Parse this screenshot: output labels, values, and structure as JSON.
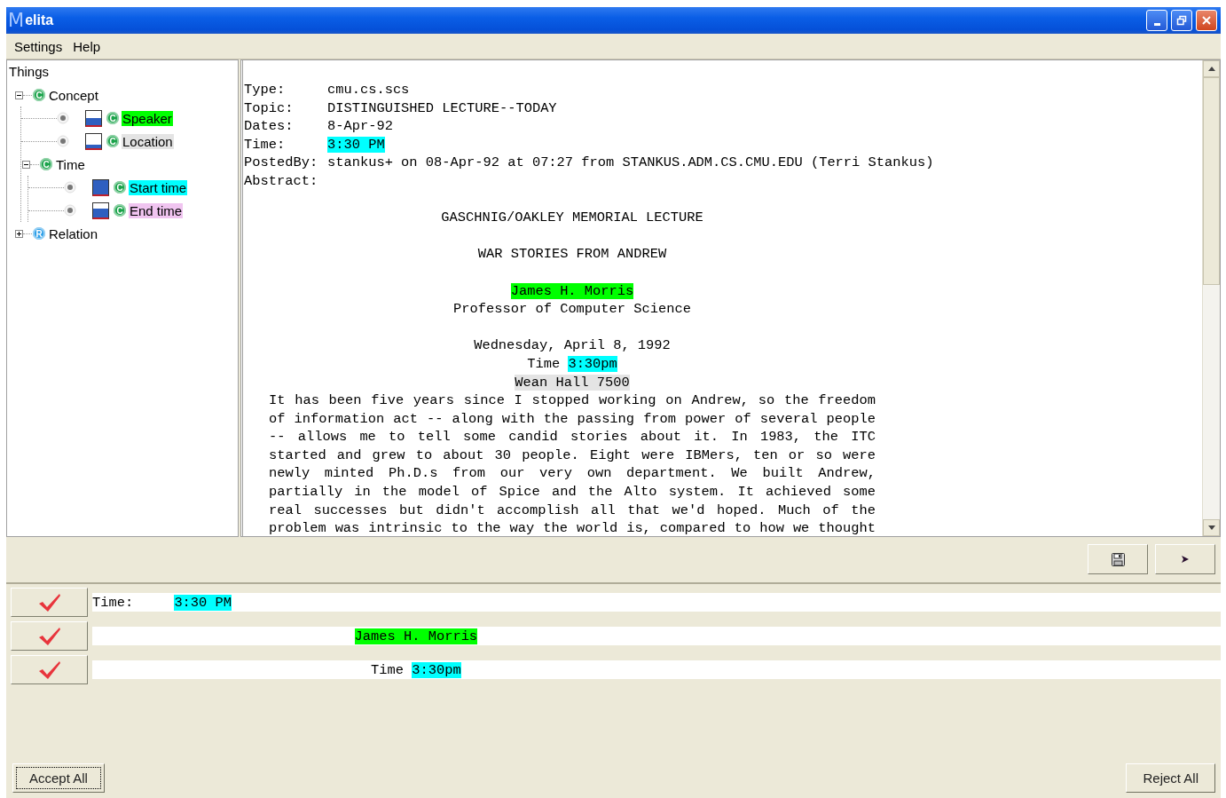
{
  "window": {
    "logo": "M",
    "title": "elita"
  },
  "menu": [
    {
      "label": "Settings"
    },
    {
      "label": "Help"
    }
  ],
  "tree": {
    "title": "Things",
    "items": [
      {
        "kind": "group",
        "badge": {
          "kind": "class",
          "letter": "C"
        },
        "label": "Concept",
        "expanded": true,
        "children": [
          {
            "kind": "slot",
            "badge": {
              "kind": "class",
              "letter": "C"
            },
            "label": "Speaker",
            "color": "#00ff00",
            "swatch": {
              "kind": "half"
            }
          },
          {
            "kind": "slot",
            "badge": {
              "kind": "class",
              "letter": "C"
            },
            "label": "Location",
            "color": "#e4e4e4",
            "swatch": {
              "kind": "low"
            }
          },
          {
            "kind": "group",
            "badge": {
              "kind": "class",
              "letter": "C"
            },
            "label": "Time",
            "expanded": true,
            "children": [
              {
                "kind": "slot",
                "badge": {
                  "kind": "class",
                  "letter": "C"
                },
                "label": "Start time",
                "color": "#00ffff",
                "swatch": {
                  "kind": "full"
                }
              },
              {
                "kind": "slot",
                "badge": {
                  "kind": "class",
                  "letter": "C"
                },
                "label": "End time",
                "color": "#f0c4f0",
                "swatch": {
                  "kind": "most"
                }
              }
            ]
          }
        ]
      },
      {
        "kind": "group",
        "badge": {
          "kind": "relation",
          "letter": "R"
        },
        "label": "Relation",
        "expanded": false
      }
    ]
  },
  "document": {
    "lines": [
      {
        "kind": "field",
        "label": "Type:",
        "segments": [
          {
            "text": "cmu.cs.scs"
          }
        ]
      },
      {
        "kind": "field",
        "label": "Topic:",
        "segments": [
          {
            "text": "DISTINGUISHED LECTURE--TODAY"
          }
        ]
      },
      {
        "kind": "field",
        "label": "Dates:",
        "segments": [
          {
            "text": "8-Apr-92"
          }
        ]
      },
      {
        "kind": "field",
        "label": "Time:",
        "segments": [
          {
            "text": "3:30 PM",
            "color": "#00ffff"
          }
        ]
      },
      {
        "kind": "field",
        "label": "PostedBy:",
        "segments": [
          {
            "text": "stankus+ on 08-Apr-92 at 07:27 from STANKUS.ADM.CS.CMU.EDU (Terri Stankus)"
          }
        ]
      },
      {
        "kind": "field",
        "label": "Abstract:"
      },
      {
        "kind": "blank"
      },
      {
        "kind": "center",
        "segments": [
          {
            "text": "GASCHNIG/OAKLEY MEMORIAL LECTURE"
          }
        ]
      },
      {
        "kind": "blank"
      },
      {
        "kind": "center",
        "segments": [
          {
            "text": "WAR STORIES FROM ANDREW"
          }
        ]
      },
      {
        "kind": "blank"
      },
      {
        "kind": "center",
        "segments": [
          {
            "text": "James H. Morris",
            "color": "#00ff00"
          }
        ]
      },
      {
        "kind": "center",
        "segments": [
          {
            "text": "Professor of Computer Science"
          }
        ]
      },
      {
        "kind": "blank"
      },
      {
        "kind": "center",
        "segments": [
          {
            "text": "Wednesday, April 8, 1992"
          }
        ]
      },
      {
        "kind": "center",
        "segments": [
          {
            "text": "Time"
          },
          {
            "text": "3:30pm",
            "color": "#00ffff"
          }
        ]
      },
      {
        "kind": "center",
        "segments": [
          {
            "text": "Wean Hall 7500",
            "color": "#e4e4e4"
          }
        ]
      },
      {
        "kind": "justify",
        "segments": [
          {
            "text": "It  has been five years since I stopped working on Andrew, so the freedom"
          }
        ]
      },
      {
        "kind": "justify",
        "segments": [
          {
            "text": "of information act -- along with the passing from power of several people"
          }
        ]
      },
      {
        "kind": "justify",
        "segments": [
          {
            "text": "-- allows me to tell some candid stories about it. In 1983, the ITC"
          }
        ]
      },
      {
        "kind": "justify",
        "segments": [
          {
            "text": "started and grew to about 30 people. Eight were IBMers, ten or so were"
          }
        ]
      },
      {
        "kind": "justify",
        "segments": [
          {
            "text": "newly minted Ph.D.s from our very own department. We built Andrew,"
          }
        ]
      },
      {
        "kind": "justify",
        "segments": [
          {
            "text": "partially in the model of Spice and the Alto system. It achieved some"
          }
        ]
      },
      {
        "kind": "justify",
        "segments": [
          {
            "text": "real successes but didn't accomplish all that we'd hoped. Much of the"
          }
        ]
      },
      {
        "kind": "justify",
        "segments": [
          {
            "text": "problem was intrinsic to the way the world is, compared to how we thought"
          }
        ]
      }
    ]
  },
  "results": [
    {
      "segments": [
        {
          "text": "Time:     "
        },
        {
          "text": "3:30 PM",
          "color": "#00ffff"
        }
      ]
    },
    {
      "segments": [
        {
          "text": "                                James H. Morris",
          "color": "#00ff00"
        }
      ]
    },
    {
      "segments": [
        {
          "text": "                                  Time "
        },
        {
          "text": "3:30pm",
          "color": "#00ffff"
        }
      ]
    }
  ],
  "footer": {
    "accept": "Accept All",
    "reject": "Reject All"
  }
}
